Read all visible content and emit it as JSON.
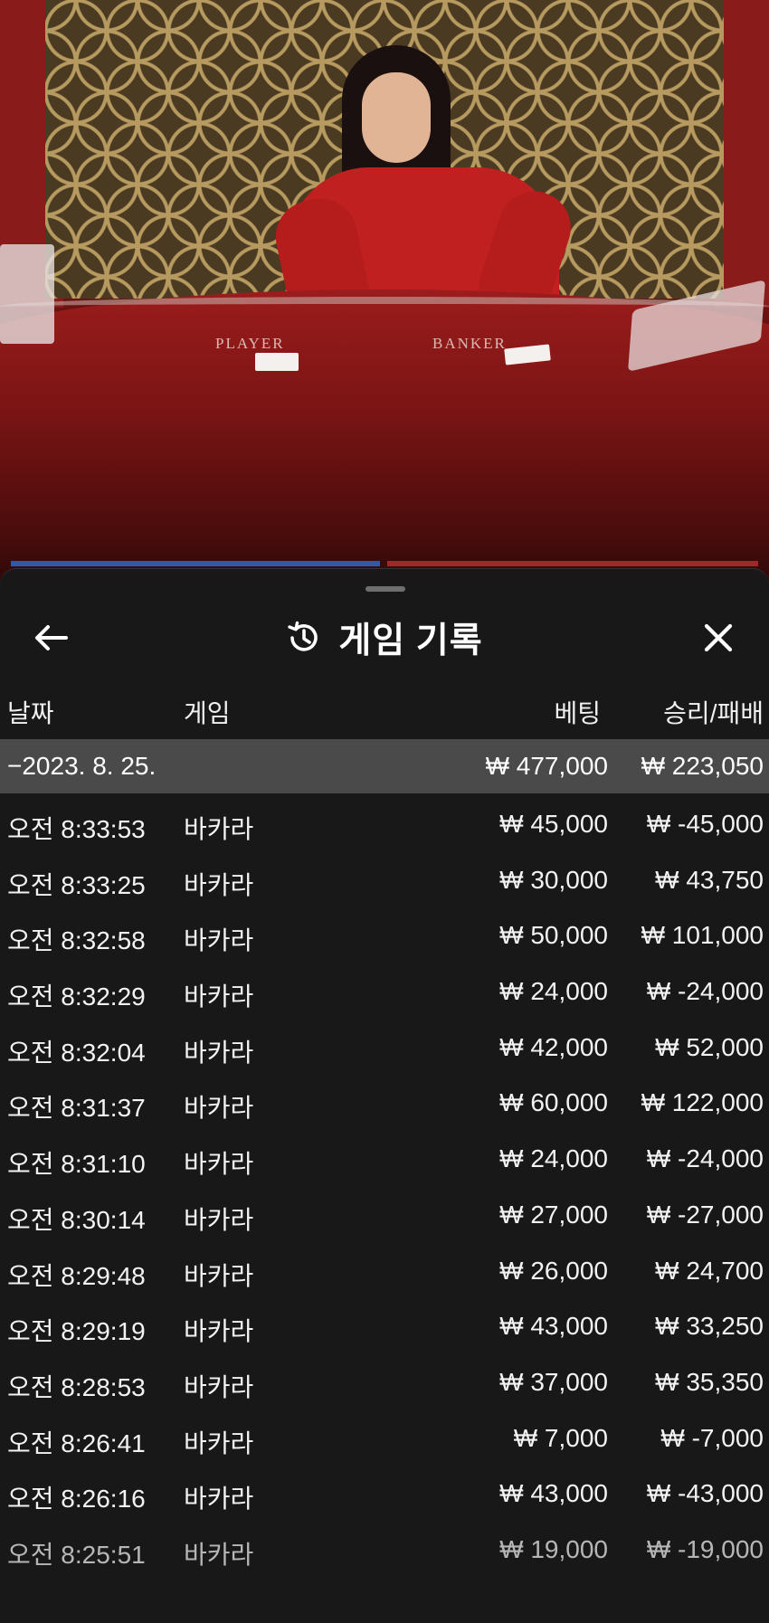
{
  "header": {
    "title": "게임 기록",
    "back_icon": "arrow-left-icon",
    "history_icon": "history-clock-icon",
    "close_icon": "close-icon"
  },
  "table_scene": {
    "player_label": "PLAYER",
    "banker_label": "BANKER"
  },
  "columns": {
    "date": "날짜",
    "game": "게임",
    "bet": "베팅",
    "result": "승리/패배"
  },
  "summary": {
    "date": "−2023. 8. 25.",
    "bet": "₩ 477,000",
    "result": "₩ 223,050"
  },
  "rows": [
    {
      "time": "오전 8:33:53",
      "game": "바카라",
      "bet": "₩ 45,000",
      "result": "₩ -45,000"
    },
    {
      "time": "오전 8:33:25",
      "game": "바카라",
      "bet": "₩ 30,000",
      "result": "₩ 43,750"
    },
    {
      "time": "오전 8:32:58",
      "game": "바카라",
      "bet": "₩ 50,000",
      "result": "₩ 101,000"
    },
    {
      "time": "오전 8:32:29",
      "game": "바카라",
      "bet": "₩ 24,000",
      "result": "₩ -24,000"
    },
    {
      "time": "오전 8:32:04",
      "game": "바카라",
      "bet": "₩ 42,000",
      "result": "₩ 52,000"
    },
    {
      "time": "오전 8:31:37",
      "game": "바카라",
      "bet": "₩ 60,000",
      "result": "₩ 122,000"
    },
    {
      "time": "오전 8:31:10",
      "game": "바카라",
      "bet": "₩ 24,000",
      "result": "₩ -24,000"
    },
    {
      "time": "오전 8:30:14",
      "game": "바카라",
      "bet": "₩ 27,000",
      "result": "₩ -27,000"
    },
    {
      "time": "오전 8:29:48",
      "game": "바카라",
      "bet": "₩ 26,000",
      "result": "₩ 24,700"
    },
    {
      "time": "오전 8:29:19",
      "game": "바카라",
      "bet": "₩ 43,000",
      "result": "₩ 33,250"
    },
    {
      "time": "오전 8:28:53",
      "game": "바카라",
      "bet": "₩ 37,000",
      "result": "₩ 35,350"
    },
    {
      "time": "오전 8:26:41",
      "game": "바카라",
      "bet": "₩ 7,000",
      "result": "₩ -7,000"
    },
    {
      "time": "오전 8:26:16",
      "game": "바카라",
      "bet": "₩ 43,000",
      "result": "₩ -43,000"
    },
    {
      "time": "오전 8:25:51",
      "game": "바카라",
      "bet": "₩ 19,000",
      "result": "₩ -19,000"
    }
  ]
}
